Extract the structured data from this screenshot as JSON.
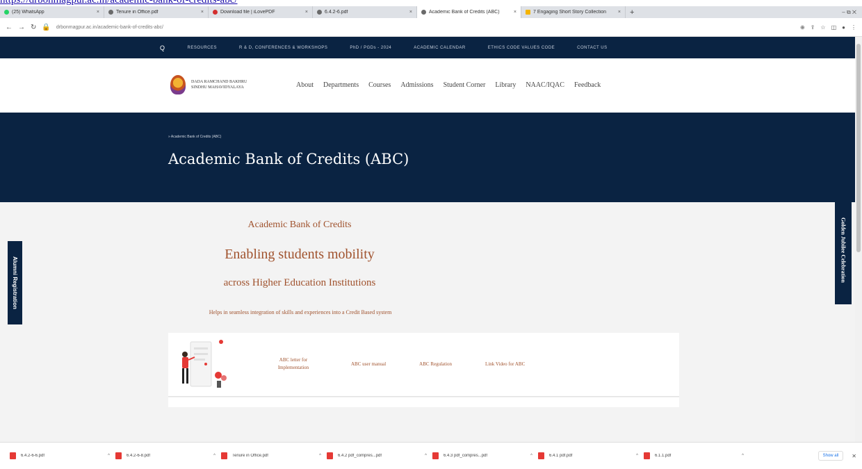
{
  "url_overlay": "https://drbonmagpur.ac.in/academic-bank-of-credits-abc/",
  "browser": {
    "tabs": [
      {
        "title": "(25) WhatsApp",
        "icon": "whatsapp-icon",
        "active": false
      },
      {
        "title": "Tenure in Office.pdf",
        "icon": "globe-icon",
        "active": false
      },
      {
        "title": "Download file | iLovePDF",
        "icon": "ilovepdf-icon",
        "active": false
      },
      {
        "title": "6.4.2-6.pdf",
        "icon": "globe-icon",
        "active": false
      },
      {
        "title": "Academic Bank of Credits (ABC)",
        "icon": "globe-icon",
        "active": true
      },
      {
        "title": "7 Engaging Short Story Collection",
        "icon": "doc-icon",
        "active": false
      }
    ],
    "new_tab": "+",
    "address": "drbonmagpur.ac.in/academic-bank-of-credits-abc/",
    "window_controls": "–  ⧉  ✕"
  },
  "site": {
    "topstrip": [
      "RESOURCES",
      "R & D, CONFERENCES & WORKSHOPS",
      "PhD / PGDs - 2024",
      "ACADEMIC CALENDAR",
      "ETHICS CODE VALUES CODE",
      "CONTACT US"
    ],
    "search_icon": "Q",
    "logo_name": [
      "DADA RAMCHAND BAKHRU",
      "SINDHU MAHAVIDYALAYA"
    ],
    "nav": [
      "About",
      "Departments",
      "Courses",
      "Admissions",
      "Student Corner",
      "Library",
      "NAAC/IQAC",
      "Feedback"
    ],
    "breadcrumb": "» Academic Bank of Credits (ABC)",
    "page_title": "Academic Bank of Credits (ABC)",
    "heading_a": "Academic Bank of Credits",
    "heading_b": "Enabling students mobility",
    "heading_c": "across Higher Education Institutions",
    "help_text": "Helps in seamless integration of skills and experiences into a Credit Based system",
    "links": [
      {
        "label": "ABC letter for Implementation"
      },
      {
        "label": "ABC user manual"
      },
      {
        "label": "ABC Regulation"
      },
      {
        "label": "Link Video for ABC"
      }
    ],
    "side_left": "Alumni Registration",
    "side_right": "Golden Jubilee Celebration"
  },
  "downloads": {
    "items": [
      "6.4.2-6-6.pdf",
      "6.4.2-6-8.pdf",
      "Tenure in Office.pdf",
      "6.4.2 pdf_compres...pdf",
      "6.4.3 pdf_compres...pdf",
      "6.4.1 pdf.pdf",
      "6.1.1.pdf"
    ],
    "show_all": "Show all",
    "close": "✕"
  },
  "colors": {
    "navy": "#0a2342",
    "accent_brown": "#a0522d"
  }
}
